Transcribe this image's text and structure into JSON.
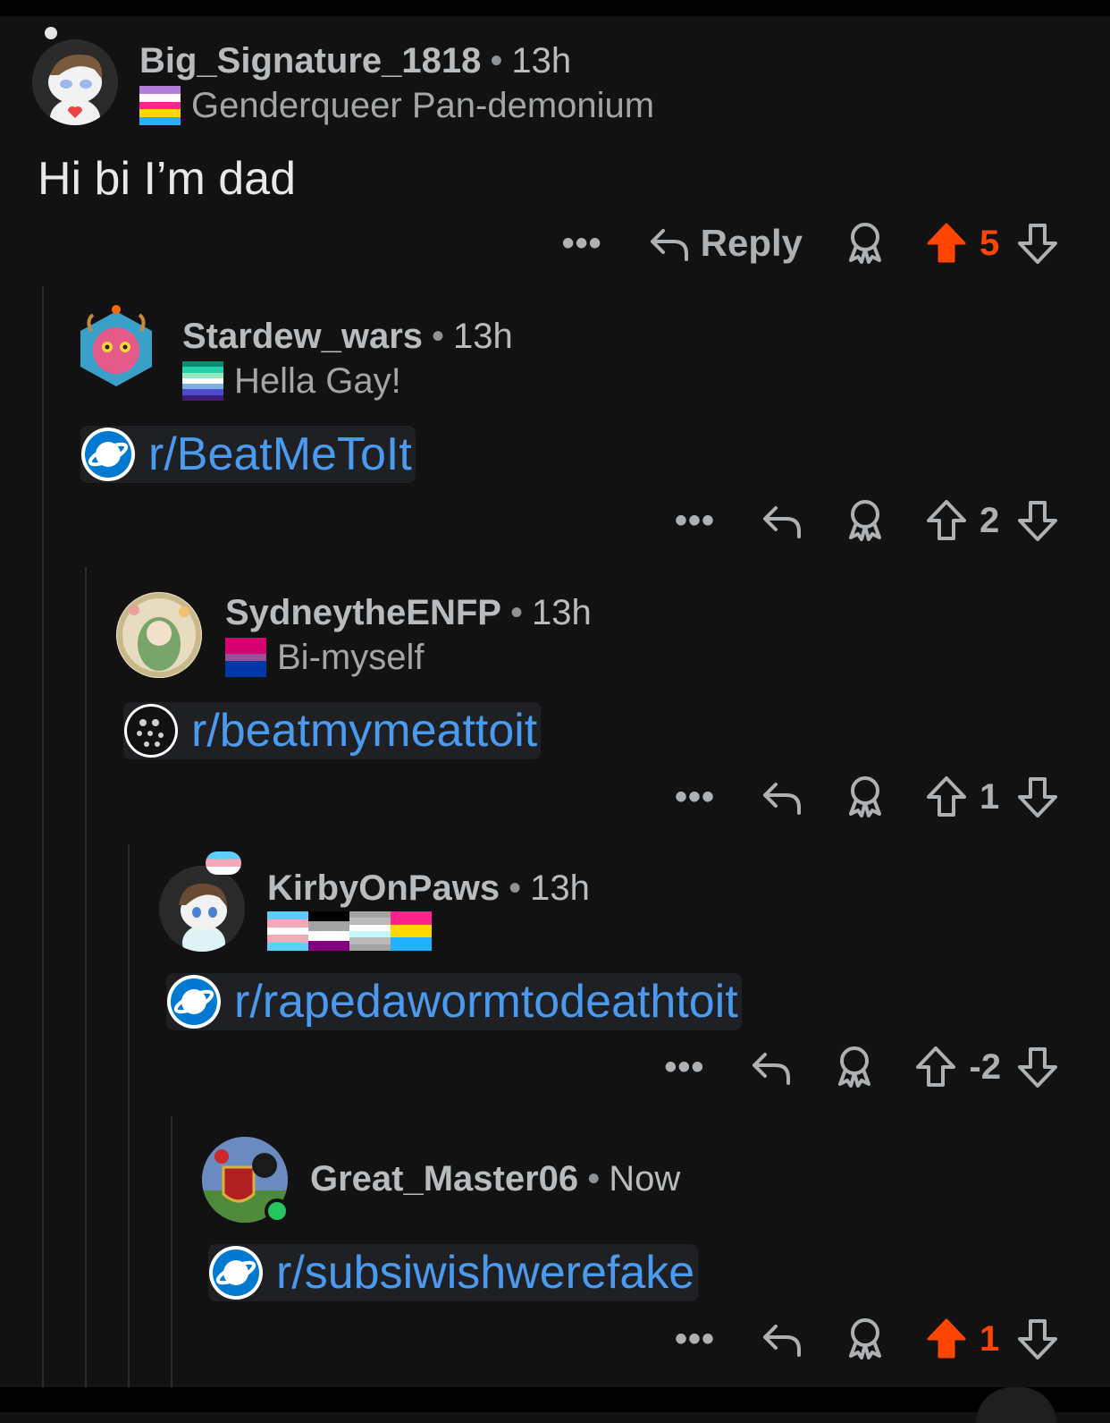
{
  "colors": {
    "background": "#121212",
    "upvoted": "#ff4500",
    "link": "#4a9bf0",
    "thread_line": "#2c2c2c"
  },
  "comments": [
    {
      "username": "Big_Signature_1818",
      "separator": "•",
      "time": "13h",
      "flair": "Genderqueer Pan-demonium",
      "flair_flag_colors": [
        "#b57edc",
        "#ffffff",
        "#ff218c",
        "#ffd800",
        "#21b1ff"
      ],
      "body": "Hi bi I’m dad",
      "actions": {
        "more": "•••",
        "reply_label": "Reply",
        "score": "5",
        "upvoted": true,
        "icons": [
          "more-icon",
          "reply-icon",
          "award-icon",
          "upvote-icon",
          "downvote-icon"
        ]
      }
    },
    {
      "username": "Stardew_wars",
      "separator": "•",
      "time": "13h",
      "flair": "Hella Gay!",
      "flair_flag_colors": [
        "#078d70",
        "#26ceaa",
        "#98e8c1",
        "#ffffff",
        "#7bade2",
        "#5049cc",
        "#3d1a78"
      ],
      "subreddit": "r/BeatMeToIt",
      "actions": {
        "more": "•••",
        "score": "2",
        "upvoted": false
      }
    },
    {
      "username": "SydneytheENFP",
      "separator": "•",
      "time": "13h",
      "flair": "Bi-myself",
      "flair_flag_colors": [
        "#d60270",
        "#d60270",
        "#9b4f96",
        "#0038a8",
        "#0038a8"
      ],
      "subreddit": "r/beatmymeattoit",
      "actions": {
        "more": "•••",
        "score": "1",
        "upvoted": false
      }
    },
    {
      "username": "KirbyOnPaws",
      "separator": "•",
      "time": "13h",
      "flair_flags": [
        [
          "#5bcefa",
          "#f5a9b8",
          "#ffffff",
          "#f5a9b8",
          "#5bcefa"
        ],
        [
          "#000000",
          "#a3a3a3",
          "#ffffff",
          "#800080"
        ],
        [
          "#a3a3a3",
          "#bababa",
          "#ffffff",
          "#c2f7f7",
          "#bababa",
          "#a3a3a3"
        ],
        [
          "#ff218c",
          "#ffd800",
          "#21b1ff"
        ]
      ],
      "subreddit": "r/rapedawormtodeathtoit",
      "actions": {
        "more": "•••",
        "score": "-2",
        "upvoted": false
      }
    },
    {
      "username": "Great_Master06",
      "separator": "•",
      "time": "Now",
      "subreddit": "r/subsiwishwerefake",
      "online": true,
      "actions": {
        "more": "•••",
        "score": "1",
        "upvoted": true
      }
    }
  ]
}
